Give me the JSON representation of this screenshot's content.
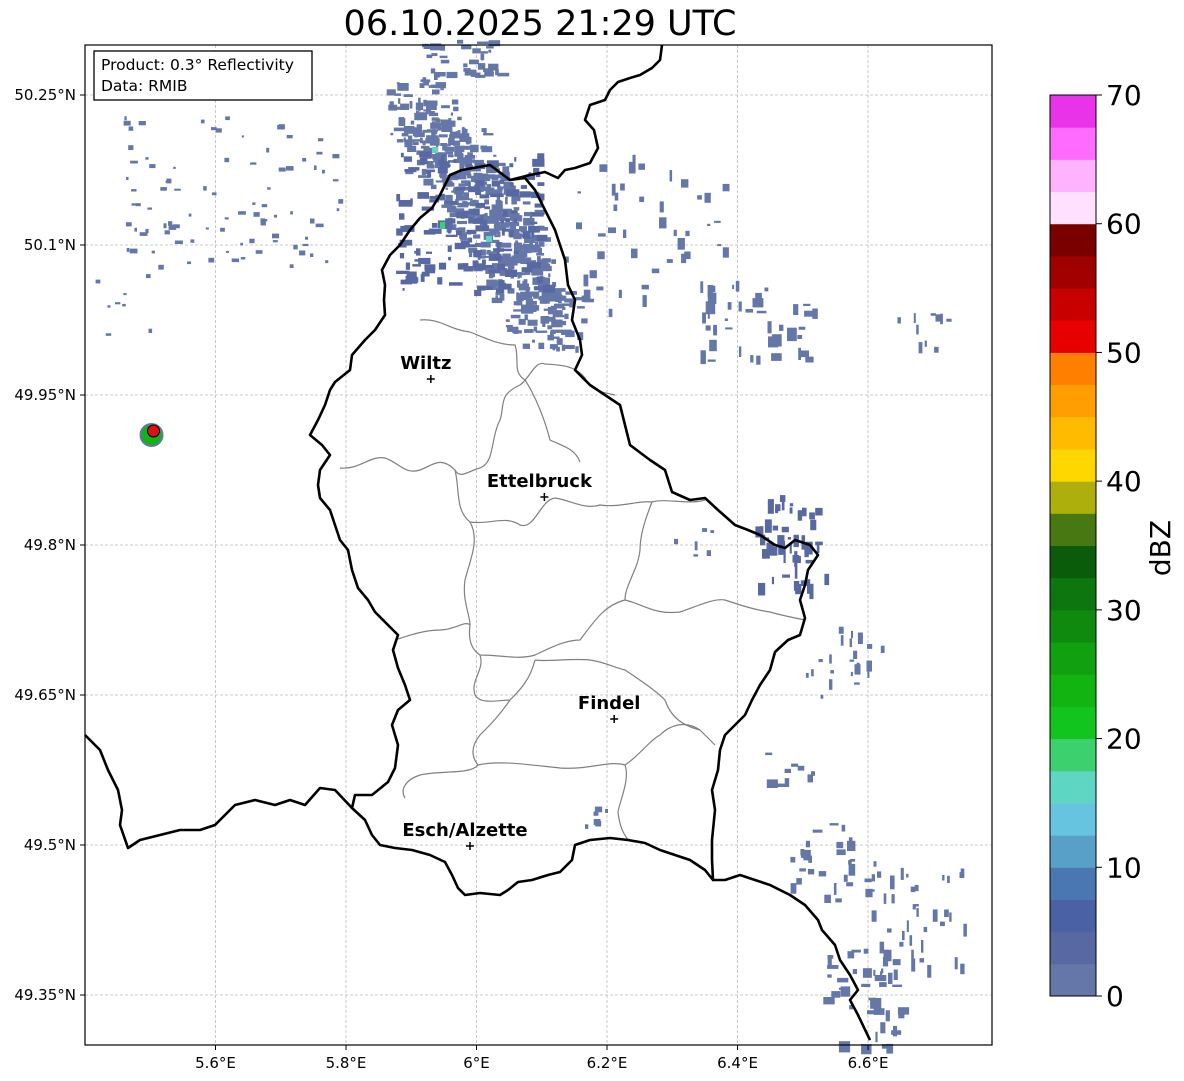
{
  "title": "06.10.2025 21:29 UTC",
  "info": {
    "product": "Product: 0.3° Reflectivity",
    "data": "Data: RMIB"
  },
  "axes": {
    "lon_range": [
      5.4,
      6.79
    ],
    "lat_range": [
      49.3,
      50.3
    ],
    "lon_ticks": [
      {
        "value": 5.6,
        "label": "5.6°E"
      },
      {
        "value": 5.8,
        "label": "5.8°E"
      },
      {
        "value": 6.0,
        "label": "6°E"
      },
      {
        "value": 6.2,
        "label": "6.2°E"
      },
      {
        "value": 6.4,
        "label": "6.4°E"
      },
      {
        "value": 6.6,
        "label": "6.6°E"
      }
    ],
    "lat_ticks": [
      {
        "value": 50.25,
        "label": "50.25°N"
      },
      {
        "value": 50.1,
        "label": "50.1°N"
      },
      {
        "value": 49.95,
        "label": "49.95°N"
      },
      {
        "value": 49.8,
        "label": "49.8°N"
      },
      {
        "value": 49.65,
        "label": "49.65°N"
      },
      {
        "value": 49.5,
        "label": "49.5°N"
      },
      {
        "value": 49.35,
        "label": "49.35°N"
      }
    ],
    "grid": true
  },
  "cities": [
    {
      "name": "Wiltz",
      "lon": 5.93,
      "lat": 49.966
    },
    {
      "name": "Ettelbruck",
      "lon": 6.104,
      "lat": 49.848
    },
    {
      "name": "Findel",
      "lon": 6.211,
      "lat": 49.626
    },
    {
      "name": "Esch/Alzette",
      "lon": 5.99,
      "lat": 49.499
    }
  ],
  "radar_site": {
    "lon": 5.505,
    "lat": 49.914,
    "color": "#dd1111"
  },
  "colorbar": {
    "label": "dBZ",
    "ticks": [
      "0",
      "10",
      "20",
      "30",
      "40",
      "50",
      "60",
      "70"
    ],
    "colors": [
      "#6577a8",
      "#5868a2",
      "#4a62a5",
      "#4a77b2",
      "#58a0c8",
      "#66c4e0",
      "#5fd6c4",
      "#3dd06f",
      "#12c41e",
      "#12b412",
      "#10a010",
      "#0f8a0f",
      "#0e760e",
      "#0a5c0a",
      "#477812",
      "#adb00c",
      "#ffd700",
      "#ffbb00",
      "#ff9e00",
      "#ff7f00",
      "#e60000",
      "#c80000",
      "#a00000",
      "#7a0000",
      "#ffe0ff",
      "#ffb3ff",
      "#ff6bff",
      "#e833e8"
    ]
  }
}
